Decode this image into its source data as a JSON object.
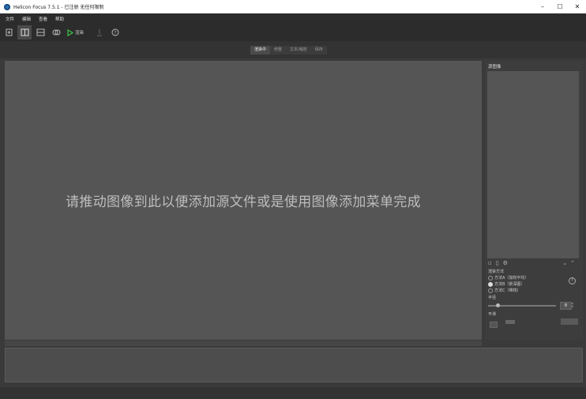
{
  "window": {
    "title": "Helicon Focus 7.5.1 - 已注册  无任何限制"
  },
  "window_controls": {
    "minimize": "–",
    "maximize": "☐",
    "close": "✕"
  },
  "menu": [
    "文件",
    "编辑",
    "查看",
    "帮助"
  ],
  "toolbar": {
    "render_label": "渲染"
  },
  "tabs": [
    {
      "label": "渲染中",
      "active": true
    },
    {
      "label": "修整",
      "active": false
    },
    {
      "label": "文本/缩放",
      "active": false
    },
    {
      "label": "保存",
      "active": false
    }
  ],
  "main": {
    "hint": "请推动图像到此以便添加源文件或是使用图像添加菜单完成"
  },
  "right_panel": {
    "title": "源图像",
    "render_method_label": "渲染方法",
    "methods": [
      {
        "label": "方法A（加权平均）",
        "selected": false
      },
      {
        "label": "方法B（景深图）",
        "selected": true
      },
      {
        "label": "方法C（堆栈）",
        "selected": false
      }
    ],
    "radius_label": "半径",
    "radius_value": "8",
    "smoothing_label": "平滑"
  },
  "colors": {
    "accent_play": "#3cc44a",
    "background": "#3a3a3a",
    "canvas": "#555555"
  }
}
